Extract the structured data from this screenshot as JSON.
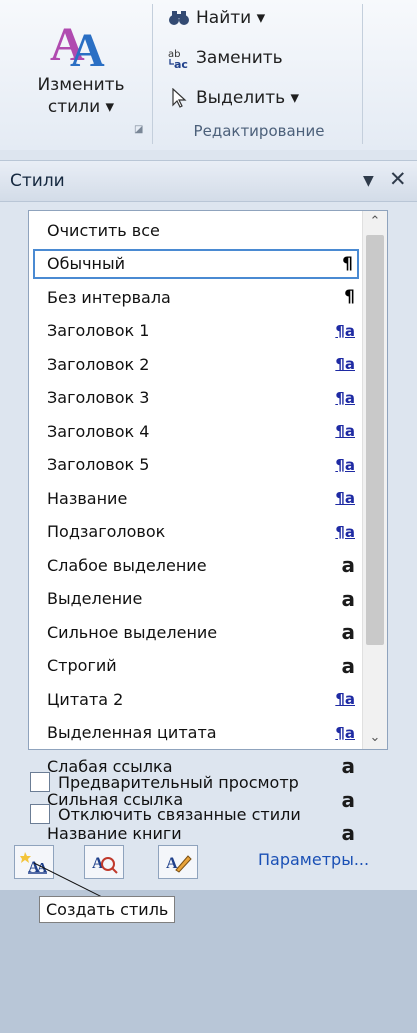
{
  "ribbon": {
    "change_styles_label_line1": "Изменить",
    "change_styles_label_line2": "стили ▾",
    "find_label": "Найти ▾",
    "replace_label": "Заменить",
    "select_label": "Выделить ▾",
    "group_label": "Редактирование"
  },
  "pane": {
    "title": "Стили",
    "dropdown_glyph": "▼",
    "close_glyph": "✕",
    "styles": [
      {
        "label": "Очистить все",
        "mark": ""
      },
      {
        "label": "Обычный",
        "mark": "¶"
      },
      {
        "label": "Без интервала",
        "mark": "¶"
      },
      {
        "label": "Заголовок 1",
        "mark": "¶a"
      },
      {
        "label": "Заголовок 2",
        "mark": "¶a"
      },
      {
        "label": "Заголовок 3",
        "mark": "¶a"
      },
      {
        "label": "Заголовок 4",
        "mark": "¶a"
      },
      {
        "label": "Заголовок 5",
        "mark": "¶a"
      },
      {
        "label": "Название",
        "mark": "¶a"
      },
      {
        "label": "Подзаголовок",
        "mark": "¶a"
      },
      {
        "label": "Слабое выделение",
        "mark": "a"
      },
      {
        "label": "Выделение",
        "mark": "a"
      },
      {
        "label": "Сильное выделение",
        "mark": "a"
      },
      {
        "label": "Строгий",
        "mark": "a"
      },
      {
        "label": "Цитата 2",
        "mark": "¶a"
      },
      {
        "label": "Выделенная цитата",
        "mark": "¶a"
      },
      {
        "label": "Слабая ссылка",
        "mark": "a"
      },
      {
        "label": "Сильная ссылка",
        "mark": "a"
      },
      {
        "label": "Название книги",
        "mark": "a"
      }
    ],
    "selected_index": 1,
    "preview_label": "Предварительный просмотр",
    "disable_linked_label": "Отключить связанные стили",
    "params_link": "Параметры...",
    "tooltip": "Создать стиль"
  },
  "colors": {
    "accent_border": "#4a8ad2",
    "link": "#1a50b5",
    "style_mark_blue": "#1e2aa3"
  }
}
